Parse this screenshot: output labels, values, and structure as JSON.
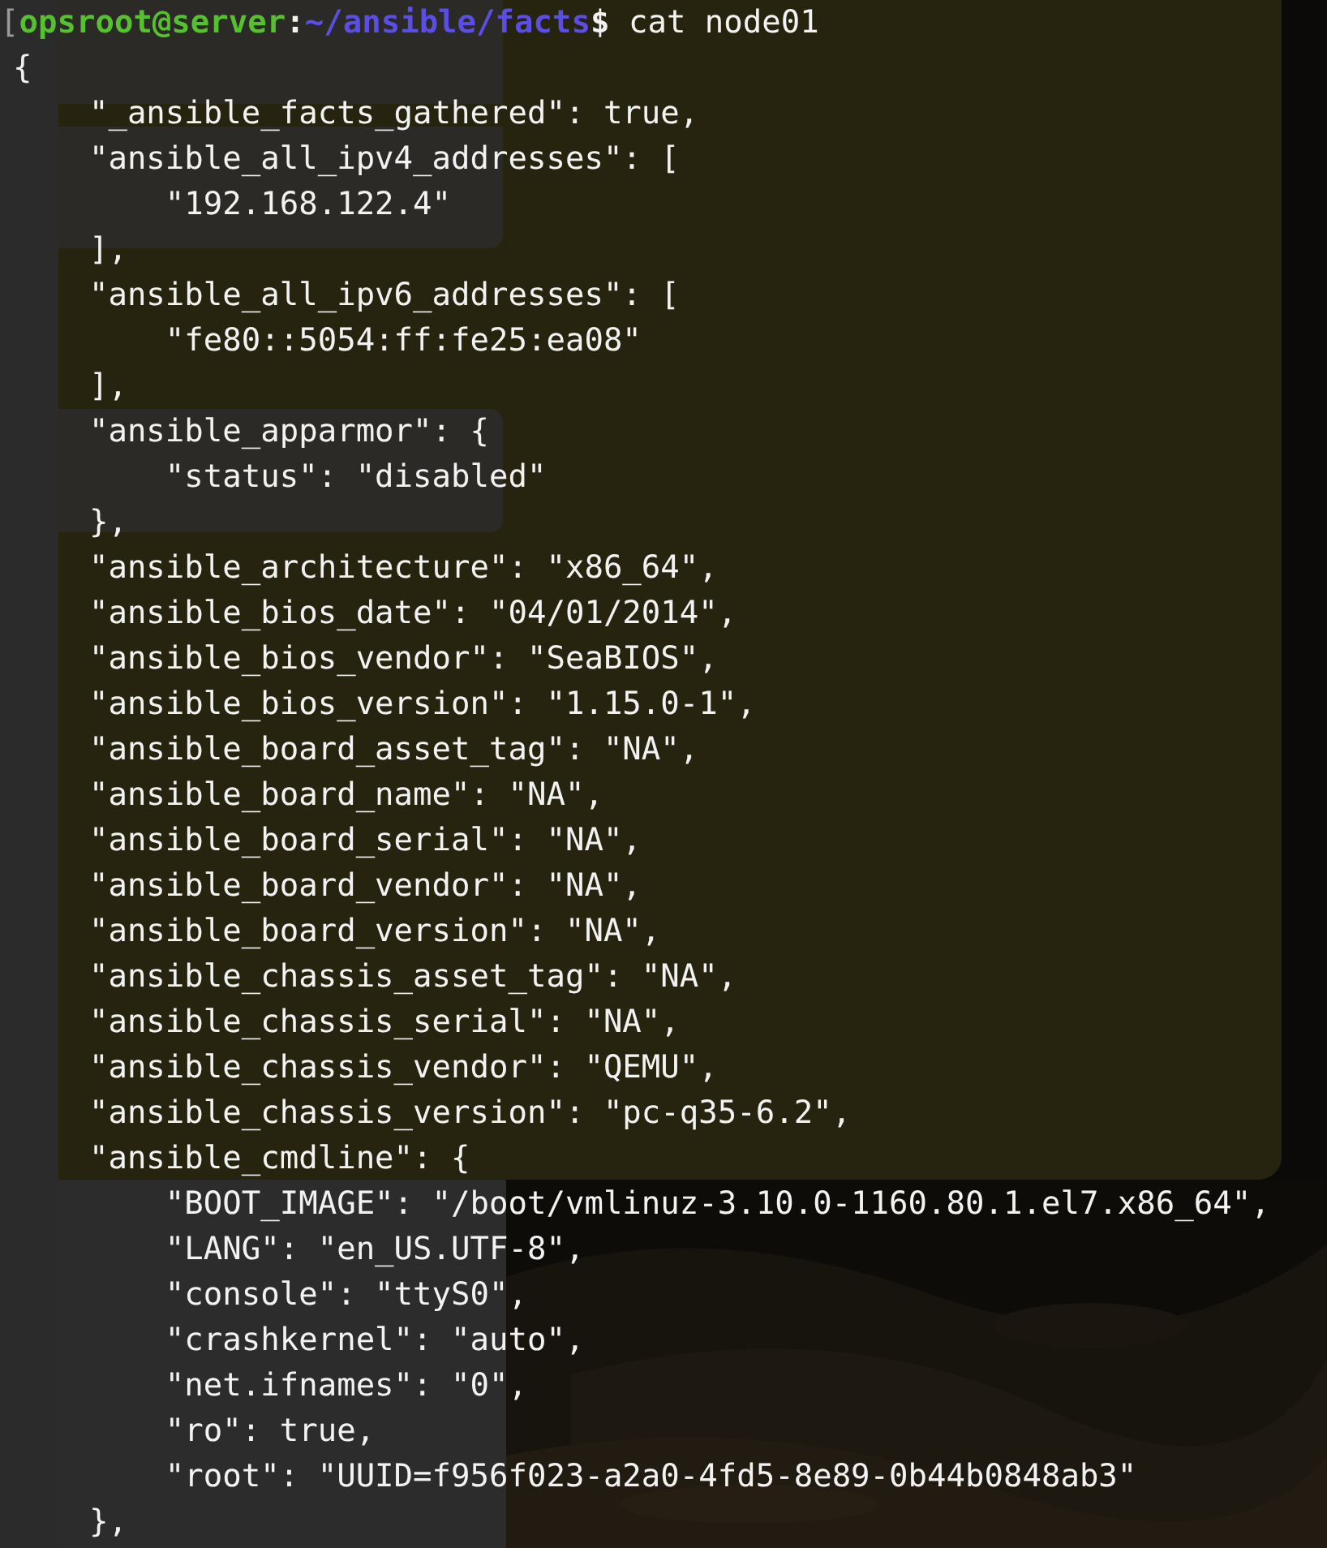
{
  "terminal": {
    "prompt": {
      "bracket": "[",
      "user_host": "opsroot@server",
      "separator": ":",
      "path": "~/ansible/facts",
      "symbol": "$",
      "command": " cat node01"
    },
    "output": [
      "{",
      "    \"_ansible_facts_gathered\": true,",
      "    \"ansible_all_ipv4_addresses\": [",
      "        \"192.168.122.4\"",
      "    ],",
      "    \"ansible_all_ipv6_addresses\": [",
      "        \"fe80::5054:ff:fe25:ea08\"",
      "    ],",
      "    \"ansible_apparmor\": {",
      "        \"status\": \"disabled\"",
      "    },",
      "    \"ansible_architecture\": \"x86_64\",",
      "    \"ansible_bios_date\": \"04/01/2014\",",
      "    \"ansible_bios_vendor\": \"SeaBIOS\",",
      "    \"ansible_bios_version\": \"1.15.0-1\",",
      "    \"ansible_board_asset_tag\": \"NA\",",
      "    \"ansible_board_name\": \"NA\",",
      "    \"ansible_board_serial\": \"NA\",",
      "    \"ansible_board_vendor\": \"NA\",",
      "    \"ansible_board_version\": \"NA\",",
      "    \"ansible_chassis_asset_tag\": \"NA\",",
      "    \"ansible_chassis_serial\": \"NA\",",
      "    \"ansible_chassis_vendor\": \"QEMU\",",
      "    \"ansible_chassis_version\": \"pc-q35-6.2\",",
      "    \"ansible_cmdline\": {",
      "        \"BOOT_IMAGE\": \"/boot/vmlinuz-3.10.0-1160.80.1.el7.x86_64\",",
      "        \"LANG\": \"en_US.UTF-8\",",
      "        \"console\": \"ttyS0\",",
      "        \"crashkernel\": \"auto\",",
      "        \"net.ifnames\": \"0\",",
      "        \"ro\": true,",
      "        \"root\": \"UUID=f956f023-a2a0-4fd5-8e89-0b44b0848ab3\"",
      "    },"
    ]
  }
}
